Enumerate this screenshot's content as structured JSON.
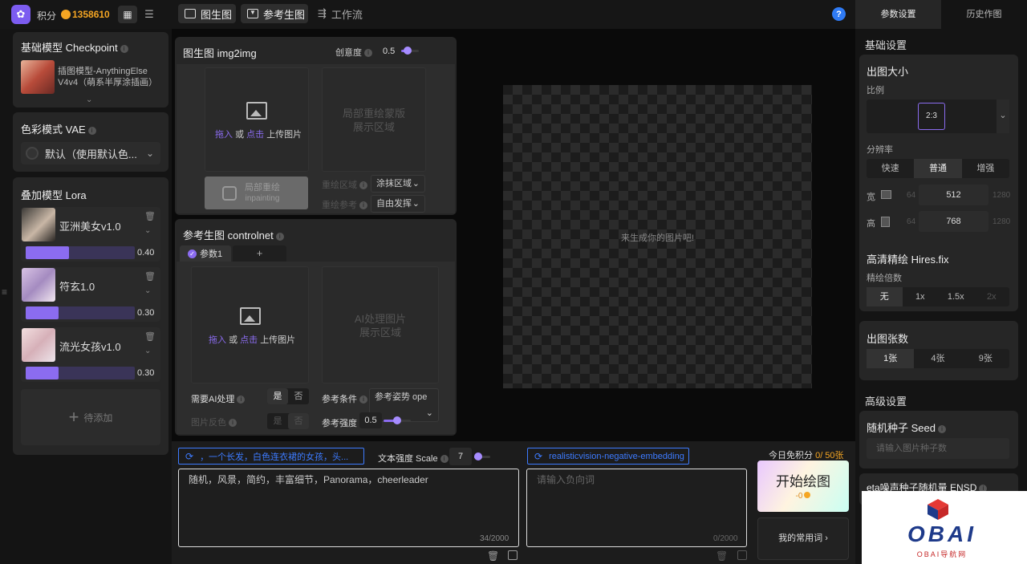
{
  "header": {
    "points_label": "积分",
    "points_value": "1358610",
    "tabs": [
      {
        "label": "图生图"
      },
      {
        "label": "参考生图"
      },
      {
        "label": "工作流"
      }
    ]
  },
  "left": {
    "checkpoint": {
      "title": "基础模型 Checkpoint",
      "model_name": "插图模型-AnythingElse V4v4（萌系半厚涂插画）"
    },
    "vae": {
      "title": "色彩模式 VAE",
      "value": "默认（使用默认色..."
    },
    "lora": {
      "title": "叠加模型 Lora",
      "items": [
        {
          "name": "亚洲美女v1.0",
          "weight": "0.40",
          "fill": 0.4
        },
        {
          "name": "符玄1.0",
          "weight": "0.30",
          "fill": 0.3
        },
        {
          "name": "流光女孩v1.0",
          "weight": "0.30",
          "fill": 0.3
        }
      ],
      "add_label": "待添加"
    }
  },
  "img2img": {
    "title": "图生图 img2img",
    "creativity_label": "创意度",
    "creativity_value": "0.5",
    "creativity_fill": 0.5,
    "upload": {
      "drag": "拖入",
      "or": "或",
      "click": "点击",
      "upload": "上传图片"
    },
    "mask_line1": "局部重绘蒙版",
    "mask_line2": "展示区域",
    "inpaint_line1": "局部重绘",
    "inpaint_line2": "inpainting",
    "redraw_area_label": "重绘区域",
    "redraw_area_value": "涂抹区域",
    "redraw_ref_label": "重绘参考",
    "redraw_ref_value": "自由发挥"
  },
  "controlnet": {
    "title": "参考生图 controlnet",
    "tab_param": "参数1",
    "tab_add": "+",
    "upload": {
      "drag": "拖入",
      "or": "或",
      "click": "点击",
      "upload": "上传图片"
    },
    "ai_line1": "AI处理图片",
    "ai_line2": "展示区域",
    "need_ai_label": "需要AI处理",
    "yes": "是",
    "no": "否",
    "invert_label": "图片反色",
    "condition_label": "参考条件",
    "condition_value": "参考姿势 ope",
    "strength_label": "参考强度",
    "strength_value": "0.5",
    "strength_fill": 0.5
  },
  "canvas": {
    "placeholder": "来生成你的图片吧!"
  },
  "prompt": {
    "tag": "，一个长发，白色连衣裙的女孩，头...",
    "scale_label": "文本强度 Scale",
    "scale_value": "7",
    "scale_fill": 0.1,
    "text": "随机，风景，简约，丰富细节，Panorama，cheerleader",
    "count": "34/2000"
  },
  "negative": {
    "tag": "realisticvision-negative-embedding",
    "placeholder": "请输入负向词",
    "count": "0/2000"
  },
  "generate": {
    "free_label": "今日免积分",
    "free_value": "0",
    "free_total": "/ 50张",
    "button_label": "开始绘图",
    "cost": "-0",
    "common_words": "我的常用词"
  },
  "right": {
    "tabs": [
      {
        "label": "参数设置"
      },
      {
        "label": "历史作图"
      }
    ],
    "basic_title": "基础设置",
    "size_title": "出图大小",
    "ratio_label": "比例",
    "ratio_value": "2:3",
    "resolution_label": "分辨率",
    "resolution_options": [
      "快速",
      "普通",
      "增强"
    ],
    "width_label": "宽",
    "width_min": "64",
    "width_value": "512",
    "width_max": "1280",
    "height_label": "高",
    "height_min": "64",
    "height_value": "768",
    "height_max": "1280",
    "hires_title": "高清精绘 Hires.fix",
    "hires_label": "精绘倍数",
    "hires_options": [
      "无",
      "1x",
      "1.5x",
      "2x"
    ],
    "count_title": "出图张数",
    "count_options": [
      "1张",
      "4张",
      "9张"
    ],
    "advanced_title": "高级设置",
    "seed_title": "随机种子 Seed",
    "seed_placeholder": "请输入图片种子数",
    "eta_title": "eta噪声种子随机量 ENSD"
  },
  "watermark": {
    "brand": "OBAI",
    "sub": "OBAI导航网"
  },
  "colors": {
    "accent": "#8b6cf0",
    "gold": "#f5a623",
    "link_blue": "#3d7bff"
  }
}
